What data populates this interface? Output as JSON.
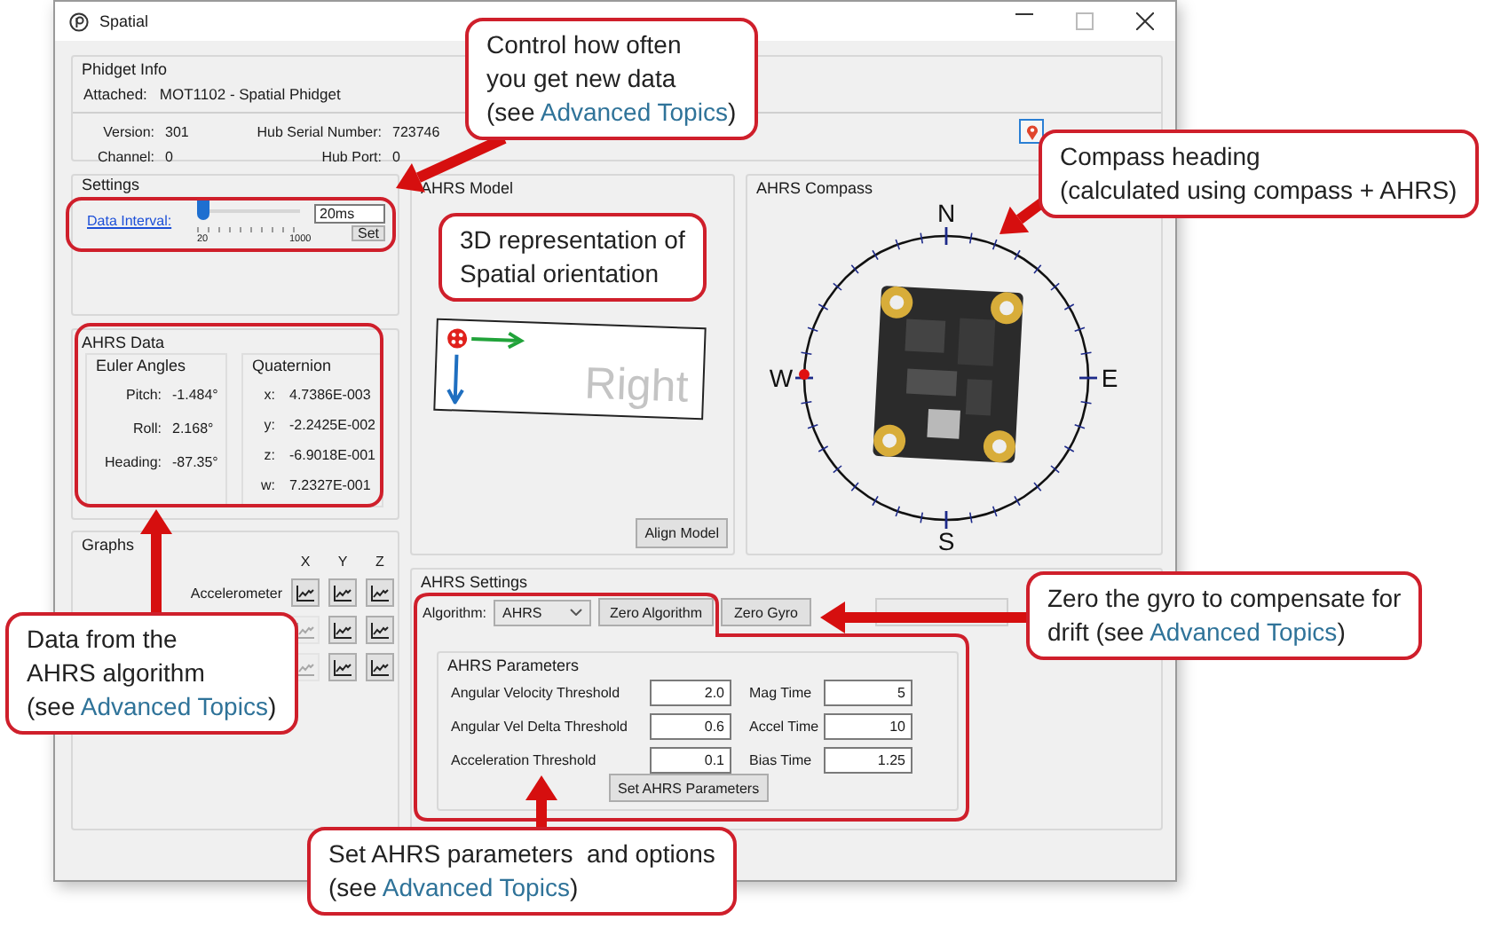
{
  "window": {
    "title": "Spatial"
  },
  "phidget_info": {
    "title": "Phidget Info",
    "attached_label": "Attached:",
    "attached_value": "MOT1102 - Spatial Phidget",
    "rows": [
      [
        {
          "label": "Version:",
          "value": "301"
        },
        {
          "label": "Hub Serial Number:",
          "value": "723746"
        }
      ],
      [
        {
          "label": "Channel:",
          "value": "0"
        },
        {
          "label": "Hub Port:",
          "value": "0"
        }
      ]
    ]
  },
  "settings": {
    "title": "Settings",
    "data_interval_label": "Data Interval:",
    "slider": {
      "level": 0,
      "min_label": "20",
      "max_label": "1000"
    },
    "interval_value": "20ms",
    "set_button": "Set"
  },
  "ahrs_data": {
    "title": "AHRS Data",
    "euler": {
      "title": "Euler Angles",
      "rows": [
        {
          "label": "Pitch:",
          "value": "-1.484°"
        },
        {
          "label": "Roll:",
          "value": "2.168°"
        },
        {
          "label": "Heading:",
          "value": "-87.35°"
        }
      ]
    },
    "quaternion": {
      "title": "Quaternion",
      "rows": [
        {
          "label": "x:",
          "value": "4.7386E-003"
        },
        {
          "label": "y:",
          "value": "-2.2425E-002"
        },
        {
          "label": "z:",
          "value": "-6.9018E-001"
        },
        {
          "label": "w:",
          "value": "7.2327E-001"
        }
      ]
    }
  },
  "graphs": {
    "title": "Graphs",
    "columns": [
      "X",
      "Y",
      "Z"
    ],
    "rows": [
      {
        "label": "Accelerometer",
        "buttons": [
          {
            "disabled": false
          },
          {
            "disabled": false
          },
          {
            "disabled": false
          }
        ]
      },
      {
        "buttons": [
          {
            "disabled": true
          },
          {
            "disabled": false
          },
          {
            "disabled": false
          }
        ]
      },
      {
        "buttons": [
          {
            "disabled": true
          },
          {
            "disabled": false
          },
          {
            "disabled": false
          }
        ]
      }
    ]
  },
  "ahrs_model": {
    "title": "AHRS Model",
    "view_label": "Right",
    "align_button": "Align Model"
  },
  "ahrs_compass": {
    "title": "AHRS Compass",
    "directions": [
      "N",
      "E",
      "S",
      "W"
    ]
  },
  "ahrs_settings": {
    "title": "AHRS Settings",
    "algorithm_label": "Algorithm:",
    "algorithm_value": "AHRS",
    "buttons": [
      {
        "label": "Zero Algorithm",
        "disabled": false
      },
      {
        "label": "Zero Gyro",
        "disabled": false
      },
      {
        "disabled": true
      }
    ],
    "parameters": {
      "title": "AHRS Parameters",
      "fields": [
        {
          "label": "Angular Velocity Threshold",
          "value": "2.0"
        },
        {
          "label": "Mag Time",
          "value": "5"
        },
        {
          "label": "Angular Vel Delta Threshold",
          "value": "0.6"
        },
        {
          "label": "Accel Time",
          "value": "10"
        },
        {
          "label": "Acceleration Threshold",
          "value": "0.1"
        },
        {
          "label": "Bias Time",
          "value": "1.25"
        }
      ],
      "set_button": "Set AHRS Parameters"
    }
  },
  "callouts": [
    {
      "lines": [
        "Control how often",
        "you get new data"
      ],
      "link_prefix": "(see ",
      "link": "Advanced Topics",
      "link_suffix": ")"
    },
    {
      "lines": [
        "3D representation of",
        "Spatial orientation"
      ]
    },
    {
      "lines": [
        "Compass heading",
        "(calculated using compass + AHRS)"
      ]
    },
    {
      "lines": [
        "Data from the",
        "AHRS algorithm"
      ],
      "link_prefix": "(see ",
      "link": "Advanced Topics",
      "link_suffix": ")"
    },
    {
      "lines": [
        "Zero the gyro to compensate for"
      ],
      "link_prefix": "drift (see ",
      "link": "Advanced Topics",
      "link_suffix": ")"
    },
    {
      "lines": [
        "Set AHRS parameters  and options"
      ],
      "link_prefix": "(see ",
      "link": "Advanced Topics",
      "link_suffix": ")"
    }
  ]
}
